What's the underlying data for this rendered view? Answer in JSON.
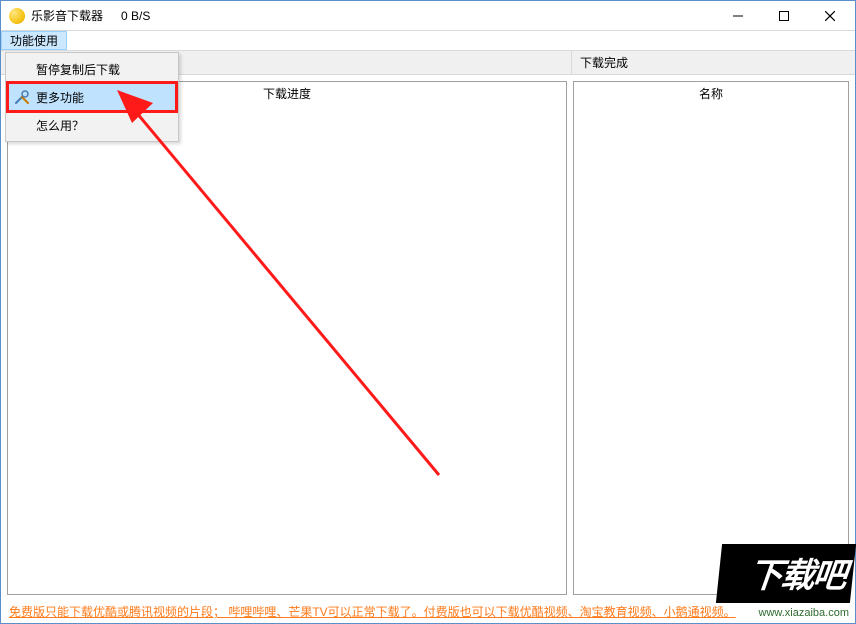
{
  "title": "乐影音下载器",
  "speed": "0 B/S",
  "menubar": {
    "functions": "功能使用"
  },
  "headers": {
    "complete": "下载完成",
    "progress": "下载进度",
    "name": "名称"
  },
  "dropdown": {
    "pause": "暂停复制后下载",
    "more": "更多功能",
    "help": "怎么用？"
  },
  "footer": "免费版只能下载优酷或腾讯视频的片段；  哔哩哔哩、芒果TV可以正常下载了。付费版也可以下载优酷视频、淘宝教育视频、小鹅通视频。",
  "watermark": {
    "brand": "下载吧",
    "url": "www.xiazaiba.com"
  }
}
